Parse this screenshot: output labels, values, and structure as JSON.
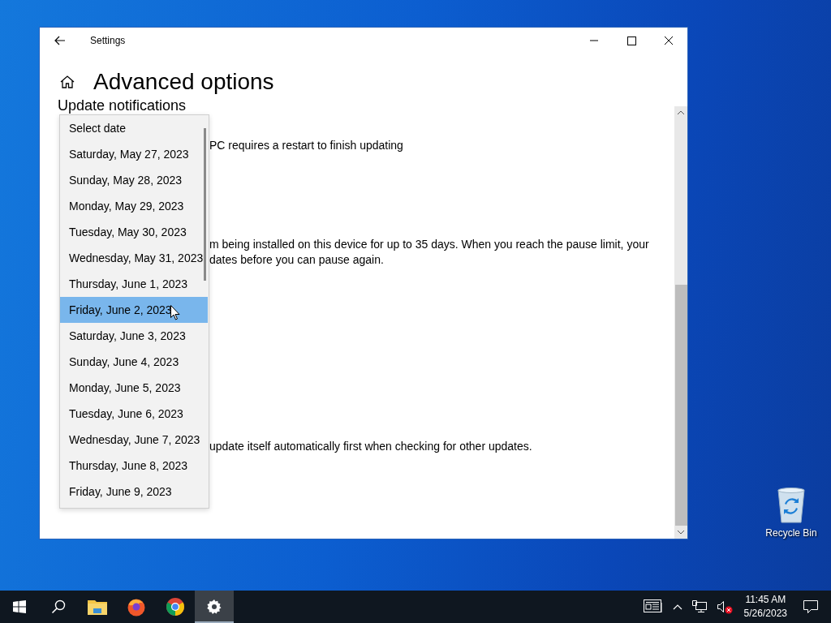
{
  "window": {
    "title": "Settings",
    "heading": "Advanced options",
    "section_heading": "Update notifications",
    "lines": [
      "PC requires a restart to finish updating",
      "m being installed on this device for up to 35 days. When you reach the pause limit, your",
      "dates before you can pause again.",
      "update itself automatically first when checking for other updates."
    ]
  },
  "date_dropdown": {
    "items": [
      {
        "label": "Select date",
        "selected": false
      },
      {
        "label": "Saturday, May 27, 2023",
        "selected": false
      },
      {
        "label": "Sunday, May 28, 2023",
        "selected": false
      },
      {
        "label": "Monday, May 29, 2023",
        "selected": false
      },
      {
        "label": "Tuesday, May 30, 2023",
        "selected": false
      },
      {
        "label": "Wednesday, May 31, 2023",
        "selected": false
      },
      {
        "label": "Thursday, June 1, 2023",
        "selected": false
      },
      {
        "label": "Friday, June 2, 2023",
        "selected": true
      },
      {
        "label": "Saturday, June 3, 2023",
        "selected": false
      },
      {
        "label": "Sunday, June 4, 2023",
        "selected": false
      },
      {
        "label": "Monday, June 5, 2023",
        "selected": false
      },
      {
        "label": "Tuesday, June 6, 2023",
        "selected": false
      },
      {
        "label": "Wednesday, June 7, 2023",
        "selected": false
      },
      {
        "label": "Thursday, June 8, 2023",
        "selected": false
      },
      {
        "label": "Friday, June 9, 2023",
        "selected": false
      }
    ]
  },
  "desktop": {
    "icons": [
      {
        "label": "Recycle Bin"
      }
    ]
  },
  "taskbar": {
    "apps": [
      {
        "kind": "start",
        "active": false
      },
      {
        "kind": "search",
        "active": false
      },
      {
        "kind": "explorer",
        "active": false
      },
      {
        "kind": "firefox",
        "active": false
      },
      {
        "kind": "chrome",
        "active": false
      },
      {
        "kind": "settings",
        "active": true
      }
    ],
    "volume_muted": true,
    "clock": {
      "time": "11:45 AM",
      "date": "5/26/2023"
    }
  }
}
